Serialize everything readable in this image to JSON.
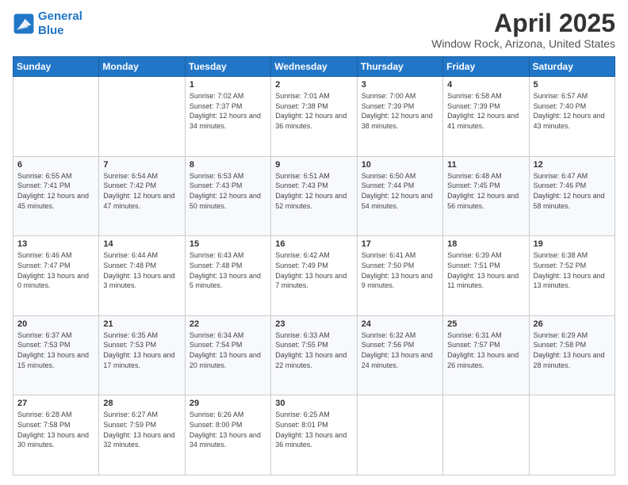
{
  "header": {
    "logo_line1": "General",
    "logo_line2": "Blue",
    "title": "April 2025",
    "subtitle": "Window Rock, Arizona, United States"
  },
  "days_of_week": [
    "Sunday",
    "Monday",
    "Tuesday",
    "Wednesday",
    "Thursday",
    "Friday",
    "Saturday"
  ],
  "weeks": [
    [
      {
        "num": "",
        "sunrise": "",
        "sunset": "",
        "daylight": ""
      },
      {
        "num": "",
        "sunrise": "",
        "sunset": "",
        "daylight": ""
      },
      {
        "num": "1",
        "sunrise": "Sunrise: 7:02 AM",
        "sunset": "Sunset: 7:37 PM",
        "daylight": "Daylight: 12 hours and 34 minutes."
      },
      {
        "num": "2",
        "sunrise": "Sunrise: 7:01 AM",
        "sunset": "Sunset: 7:38 PM",
        "daylight": "Daylight: 12 hours and 36 minutes."
      },
      {
        "num": "3",
        "sunrise": "Sunrise: 7:00 AM",
        "sunset": "Sunset: 7:39 PM",
        "daylight": "Daylight: 12 hours and 38 minutes."
      },
      {
        "num": "4",
        "sunrise": "Sunrise: 6:58 AM",
        "sunset": "Sunset: 7:39 PM",
        "daylight": "Daylight: 12 hours and 41 minutes."
      },
      {
        "num": "5",
        "sunrise": "Sunrise: 6:57 AM",
        "sunset": "Sunset: 7:40 PM",
        "daylight": "Daylight: 12 hours and 43 minutes."
      }
    ],
    [
      {
        "num": "6",
        "sunrise": "Sunrise: 6:55 AM",
        "sunset": "Sunset: 7:41 PM",
        "daylight": "Daylight: 12 hours and 45 minutes."
      },
      {
        "num": "7",
        "sunrise": "Sunrise: 6:54 AM",
        "sunset": "Sunset: 7:42 PM",
        "daylight": "Daylight: 12 hours and 47 minutes."
      },
      {
        "num": "8",
        "sunrise": "Sunrise: 6:53 AM",
        "sunset": "Sunset: 7:43 PM",
        "daylight": "Daylight: 12 hours and 50 minutes."
      },
      {
        "num": "9",
        "sunrise": "Sunrise: 6:51 AM",
        "sunset": "Sunset: 7:43 PM",
        "daylight": "Daylight: 12 hours and 52 minutes."
      },
      {
        "num": "10",
        "sunrise": "Sunrise: 6:50 AM",
        "sunset": "Sunset: 7:44 PM",
        "daylight": "Daylight: 12 hours and 54 minutes."
      },
      {
        "num": "11",
        "sunrise": "Sunrise: 6:48 AM",
        "sunset": "Sunset: 7:45 PM",
        "daylight": "Daylight: 12 hours and 56 minutes."
      },
      {
        "num": "12",
        "sunrise": "Sunrise: 6:47 AM",
        "sunset": "Sunset: 7:46 PM",
        "daylight": "Daylight: 12 hours and 58 minutes."
      }
    ],
    [
      {
        "num": "13",
        "sunrise": "Sunrise: 6:46 AM",
        "sunset": "Sunset: 7:47 PM",
        "daylight": "Daylight: 13 hours and 0 minutes."
      },
      {
        "num": "14",
        "sunrise": "Sunrise: 6:44 AM",
        "sunset": "Sunset: 7:48 PM",
        "daylight": "Daylight: 13 hours and 3 minutes."
      },
      {
        "num": "15",
        "sunrise": "Sunrise: 6:43 AM",
        "sunset": "Sunset: 7:48 PM",
        "daylight": "Daylight: 13 hours and 5 minutes."
      },
      {
        "num": "16",
        "sunrise": "Sunrise: 6:42 AM",
        "sunset": "Sunset: 7:49 PM",
        "daylight": "Daylight: 13 hours and 7 minutes."
      },
      {
        "num": "17",
        "sunrise": "Sunrise: 6:41 AM",
        "sunset": "Sunset: 7:50 PM",
        "daylight": "Daylight: 13 hours and 9 minutes."
      },
      {
        "num": "18",
        "sunrise": "Sunrise: 6:39 AM",
        "sunset": "Sunset: 7:51 PM",
        "daylight": "Daylight: 13 hours and 11 minutes."
      },
      {
        "num": "19",
        "sunrise": "Sunrise: 6:38 AM",
        "sunset": "Sunset: 7:52 PM",
        "daylight": "Daylight: 13 hours and 13 minutes."
      }
    ],
    [
      {
        "num": "20",
        "sunrise": "Sunrise: 6:37 AM",
        "sunset": "Sunset: 7:53 PM",
        "daylight": "Daylight: 13 hours and 15 minutes."
      },
      {
        "num": "21",
        "sunrise": "Sunrise: 6:35 AM",
        "sunset": "Sunset: 7:53 PM",
        "daylight": "Daylight: 13 hours and 17 minutes."
      },
      {
        "num": "22",
        "sunrise": "Sunrise: 6:34 AM",
        "sunset": "Sunset: 7:54 PM",
        "daylight": "Daylight: 13 hours and 20 minutes."
      },
      {
        "num": "23",
        "sunrise": "Sunrise: 6:33 AM",
        "sunset": "Sunset: 7:55 PM",
        "daylight": "Daylight: 13 hours and 22 minutes."
      },
      {
        "num": "24",
        "sunrise": "Sunrise: 6:32 AM",
        "sunset": "Sunset: 7:56 PM",
        "daylight": "Daylight: 13 hours and 24 minutes."
      },
      {
        "num": "25",
        "sunrise": "Sunrise: 6:31 AM",
        "sunset": "Sunset: 7:57 PM",
        "daylight": "Daylight: 13 hours and 26 minutes."
      },
      {
        "num": "26",
        "sunrise": "Sunrise: 6:29 AM",
        "sunset": "Sunset: 7:58 PM",
        "daylight": "Daylight: 13 hours and 28 minutes."
      }
    ],
    [
      {
        "num": "27",
        "sunrise": "Sunrise: 6:28 AM",
        "sunset": "Sunset: 7:58 PM",
        "daylight": "Daylight: 13 hours and 30 minutes."
      },
      {
        "num": "28",
        "sunrise": "Sunrise: 6:27 AM",
        "sunset": "Sunset: 7:59 PM",
        "daylight": "Daylight: 13 hours and 32 minutes."
      },
      {
        "num": "29",
        "sunrise": "Sunrise: 6:26 AM",
        "sunset": "Sunset: 8:00 PM",
        "daylight": "Daylight: 13 hours and 34 minutes."
      },
      {
        "num": "30",
        "sunrise": "Sunrise: 6:25 AM",
        "sunset": "Sunset: 8:01 PM",
        "daylight": "Daylight: 13 hours and 36 minutes."
      },
      {
        "num": "",
        "sunrise": "",
        "sunset": "",
        "daylight": ""
      },
      {
        "num": "",
        "sunrise": "",
        "sunset": "",
        "daylight": ""
      },
      {
        "num": "",
        "sunrise": "",
        "sunset": "",
        "daylight": ""
      }
    ]
  ]
}
